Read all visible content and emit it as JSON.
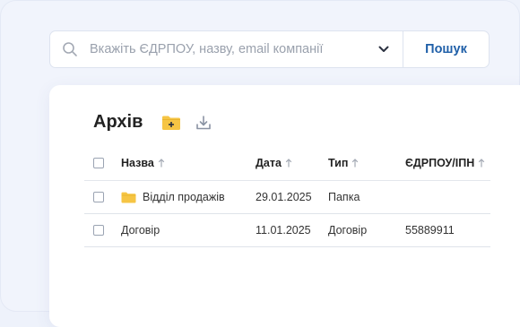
{
  "search": {
    "placeholder": "Вкажіть ЄДРПОУ, назву, email компанії",
    "button_label": "Пошук"
  },
  "archive": {
    "title": "Архів"
  },
  "table": {
    "headers": {
      "name": "Назва",
      "date": "Дата",
      "type": "Тип",
      "code": "ЄДРПОУ/ІПН"
    },
    "rows": [
      {
        "name": "Відділ продажів",
        "date": "29.01.2025",
        "type": "Папка",
        "code": "",
        "icon": "folder-icon"
      },
      {
        "name": "Договір",
        "date": "11.01.2025",
        "type": "Договір",
        "code": "55889911",
        "icon": ""
      }
    ]
  },
  "colors": {
    "accent": "#1f5fa8",
    "folder": "#f6c544",
    "background": "#eef2fb"
  }
}
